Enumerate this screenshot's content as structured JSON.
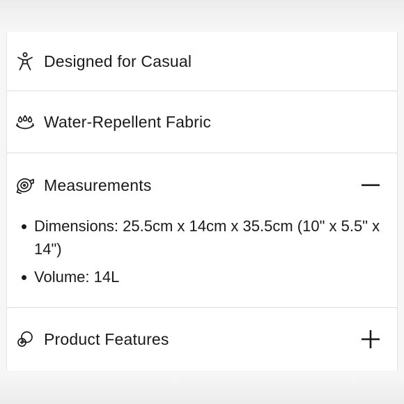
{
  "accordion": {
    "items": [
      {
        "label": "Designed for Casual",
        "icon": "person-icon",
        "expanded": false,
        "toggle": ""
      },
      {
        "label": "Water-Repellent Fabric",
        "icon": "water-drops-icon",
        "expanded": false,
        "toggle": ""
      },
      {
        "label": "Measurements",
        "icon": "tape-measure-icon",
        "expanded": true,
        "toggle": "collapse",
        "details": [
          "Dimensions: 25.5cm x 14cm x 35.5cm (10\" x 5.5\" x 14\")",
          "Volume: 14L"
        ]
      },
      {
        "label": "Product Features",
        "icon": "features-icon",
        "expanded": false,
        "toggle": "expand"
      }
    ]
  },
  "colors": {
    "text": "#1a1a1a",
    "divider": "#dedede",
    "background": "#ffffff"
  }
}
